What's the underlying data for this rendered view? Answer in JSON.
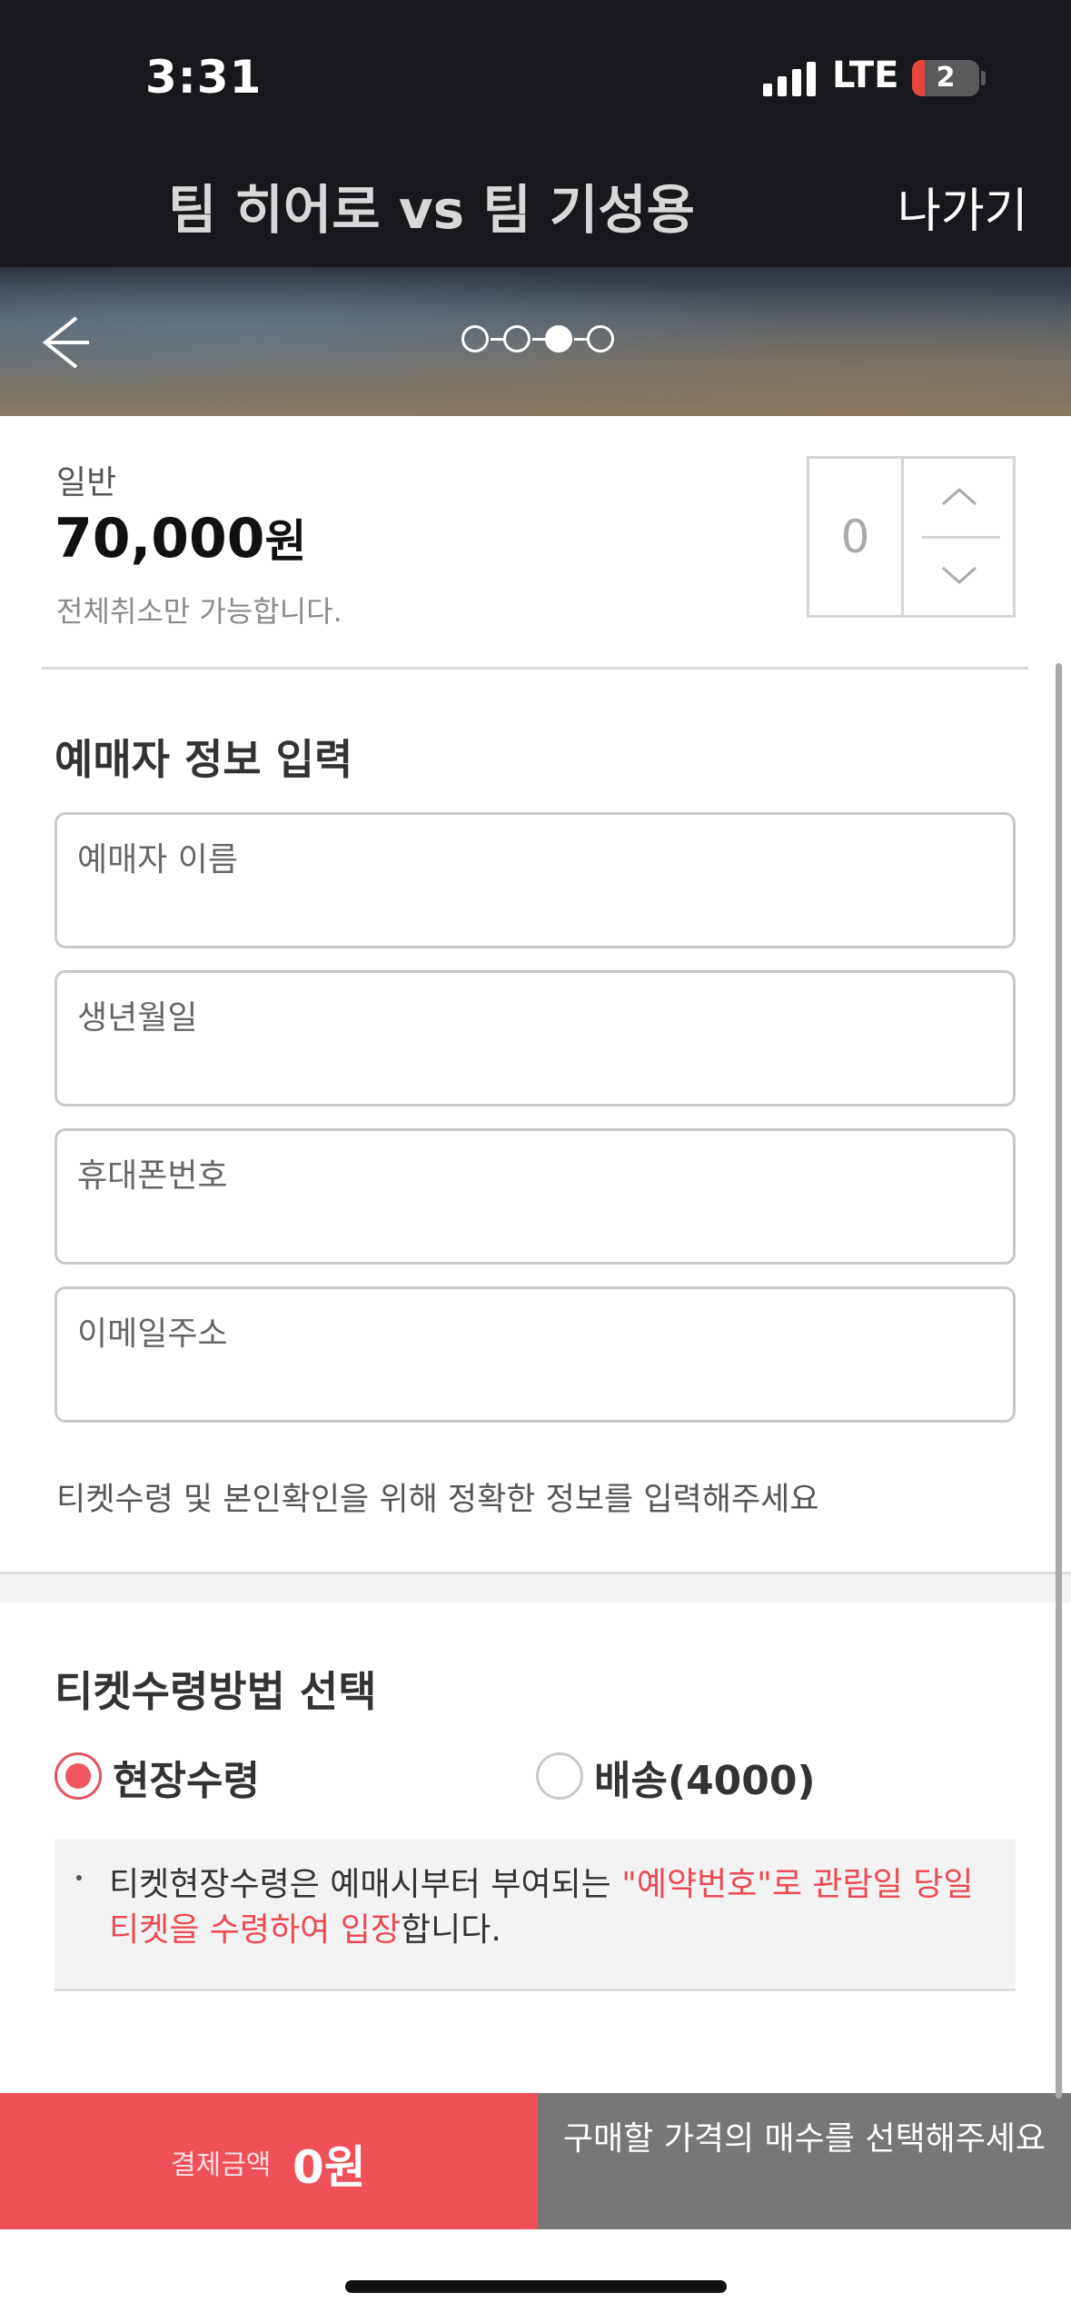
{
  "status_bar": {
    "time": "3:31",
    "network": "LTE",
    "battery": "2"
  },
  "header": {
    "title": "팀 히어로 vs 팀 기성용",
    "exit_label": "나가기"
  },
  "progress": {
    "total_steps": 4,
    "current_step": 3
  },
  "ticket": {
    "type": "일반",
    "price": "70,000",
    "price_unit": "원",
    "note": "전체취소만 가능합니다.",
    "quantity": "0"
  },
  "booker_info": {
    "title": "예매자 정보 입력",
    "fields": [
      {
        "label": "예매자 이름",
        "value": ""
      },
      {
        "label": "생년월일",
        "value": ""
      },
      {
        "label": "휴대폰번호",
        "value": ""
      },
      {
        "label": "이메일주소",
        "value": ""
      }
    ],
    "help_text": "티켓수령 및 본인확인을 위해 정확한 정보를 입력해주세요"
  },
  "receive_method": {
    "title": "티켓수령방법 선택",
    "options": [
      {
        "label": "현장수령",
        "selected": true
      },
      {
        "label": "배송(4000)",
        "selected": false
      }
    ],
    "notice_part1": "티켓현장수령은 예매시부터 부여되는 ",
    "notice_highlight1": "\"예약번호\"로 관람일 당일 티켓을 수령하여 입장",
    "notice_part2": "합니다."
  },
  "bottom_bar": {
    "pay_label": "결제금액",
    "pay_amount": "0원",
    "action_text": "구매할 가격의 매수를 선택해주세요"
  },
  "colors": {
    "accent": "#f05058",
    "header_bg": "#16181b",
    "disabled_bg": "#777777"
  }
}
